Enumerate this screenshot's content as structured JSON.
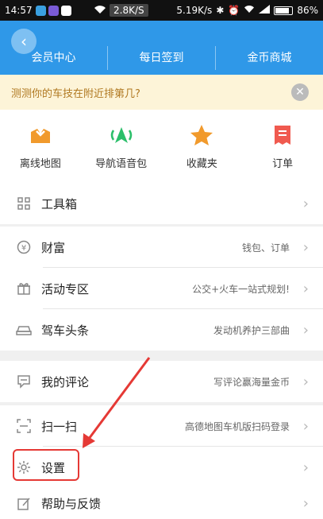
{
  "status_bar": {
    "time": "14:57",
    "net_speed_left": "2.8K/S",
    "net_speed_right": "5.19K/s",
    "battery": "86%",
    "battery_level": 0.86
  },
  "header": {
    "tabs": [
      "会员中心",
      "每日签到",
      "金币商城"
    ]
  },
  "banner": {
    "text": "测测你的车技在附近排第几?"
  },
  "quick_actions": [
    {
      "label": "离线地图",
      "icon": "offline-map-icon",
      "color": "#f19a2c"
    },
    {
      "label": "导航语音包",
      "icon": "voice-pack-icon",
      "color": "#2bbf6a"
    },
    {
      "label": "收藏夹",
      "icon": "star-icon",
      "color": "#f19a2c"
    },
    {
      "label": "订单",
      "icon": "order-icon",
      "color": "#f05a4f"
    }
  ],
  "menu": {
    "toolbox": {
      "label": "工具箱"
    },
    "wealth": {
      "label": "财富",
      "hint": "钱包、订单"
    },
    "events": {
      "label": "活动专区",
      "hint": "公交+火车一站式规划!"
    },
    "driving_news": {
      "label": "驾车头条",
      "hint": "发动机养护三部曲"
    },
    "reviews": {
      "label": "我的评论",
      "hint": "写评论赢海量金币"
    },
    "scan": {
      "label": "扫一扫",
      "hint": "高德地图车机版扫码登录"
    },
    "settings": {
      "label": "设置"
    },
    "help": {
      "label": "帮助与反馈"
    }
  },
  "colors": {
    "header_blue": "#2f98e8",
    "highlight_red": "#e53935"
  }
}
